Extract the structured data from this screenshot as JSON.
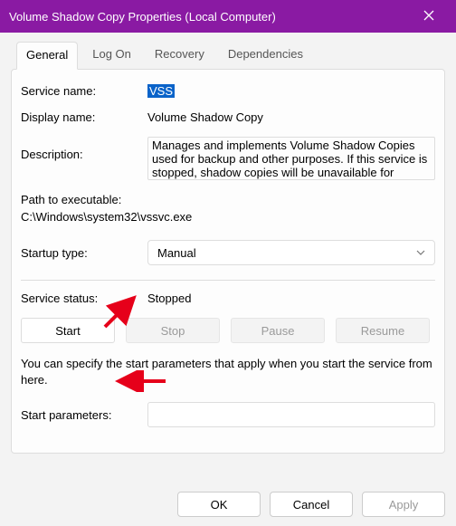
{
  "window": {
    "title": "Volume Shadow Copy Properties (Local Computer)"
  },
  "tabs": {
    "items": [
      "General",
      "Log On",
      "Recovery",
      "Dependencies"
    ],
    "active": 0
  },
  "labels": {
    "service_name": "Service name:",
    "display_name": "Display name:",
    "description": "Description:",
    "path": "Path to executable:",
    "startup_type": "Startup type:",
    "service_status": "Service status:",
    "start_parameters": "Start parameters:"
  },
  "values": {
    "service_name": "VSS",
    "display_name": "Volume Shadow Copy",
    "description": "Manages and implements Volume Shadow Copies used for backup and other purposes. If this service is stopped, shadow copies will be unavailable for",
    "path": "C:\\Windows\\system32\\vssvc.exe",
    "startup_type": "Manual",
    "service_status": "Stopped",
    "start_parameters": ""
  },
  "buttons": {
    "start": "Start",
    "stop": "Stop",
    "pause": "Pause",
    "resume": "Resume",
    "ok": "OK",
    "cancel": "Cancel",
    "apply": "Apply"
  },
  "note": "You can specify the start parameters that apply when you start the service from here.",
  "arrow_color": "#e6001a"
}
